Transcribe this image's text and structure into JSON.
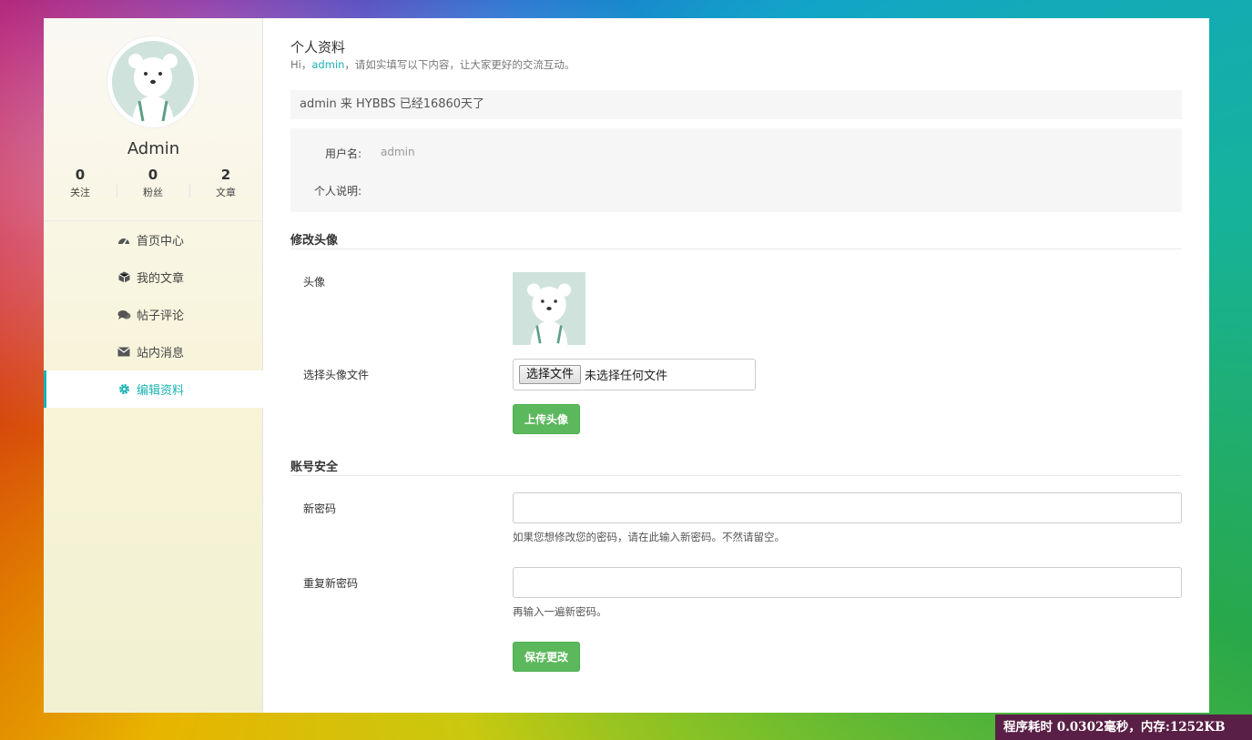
{
  "sidebar": {
    "avatar_alt": "bear avatar",
    "username": "Admin",
    "stats": [
      {
        "value": "0",
        "label": "关注"
      },
      {
        "value": "0",
        "label": "粉丝"
      },
      {
        "value": "2",
        "label": "文章"
      }
    ],
    "nav": [
      {
        "label": "首页中心",
        "icon": "dashboard-icon"
      },
      {
        "label": "我的文章",
        "icon": "cube-icon"
      },
      {
        "label": "帖子评论",
        "icon": "comments-icon"
      },
      {
        "label": "站内消息",
        "icon": "envelope-icon"
      },
      {
        "label": "编辑资料",
        "icon": "gear-icon",
        "active": true
      }
    ]
  },
  "main": {
    "title": "个人资料",
    "subtitle_prefix": "Hi，",
    "subtitle_user": "admin",
    "subtitle_suffix": "，请如实填写以下内容，让大家更好的交流互动。",
    "days_text": "admin 来 HYBBS 已经16860天了",
    "info": {
      "username_label": "用户名:",
      "username_value": "admin",
      "bio_label": "个人说明:",
      "bio_value": ""
    },
    "avatar_section": {
      "heading": "修改头像",
      "avatar_label": "头像",
      "file_label": "选择头像文件",
      "file_button": "选择文件",
      "file_status": "未选择任何文件",
      "upload_button": "上传头像"
    },
    "security_section": {
      "heading": "账号安全",
      "new_password_label": "新密码",
      "new_password_value": "",
      "new_password_hint": "如果您想修改您的密码，请在此输入新密码。不然请留空。",
      "repeat_password_label": "重复新密码",
      "repeat_password_value": "",
      "repeat_password_hint": "再输入一遍新密码。",
      "save_button": "保存更改"
    }
  },
  "footer": {
    "perf_text": "程序耗时 0.0302毫秒，内存:1252KB"
  },
  "colors": {
    "accent": "#1ab3b3",
    "button_green": "#5cb85c",
    "footer_bg": "#5a1f46"
  }
}
